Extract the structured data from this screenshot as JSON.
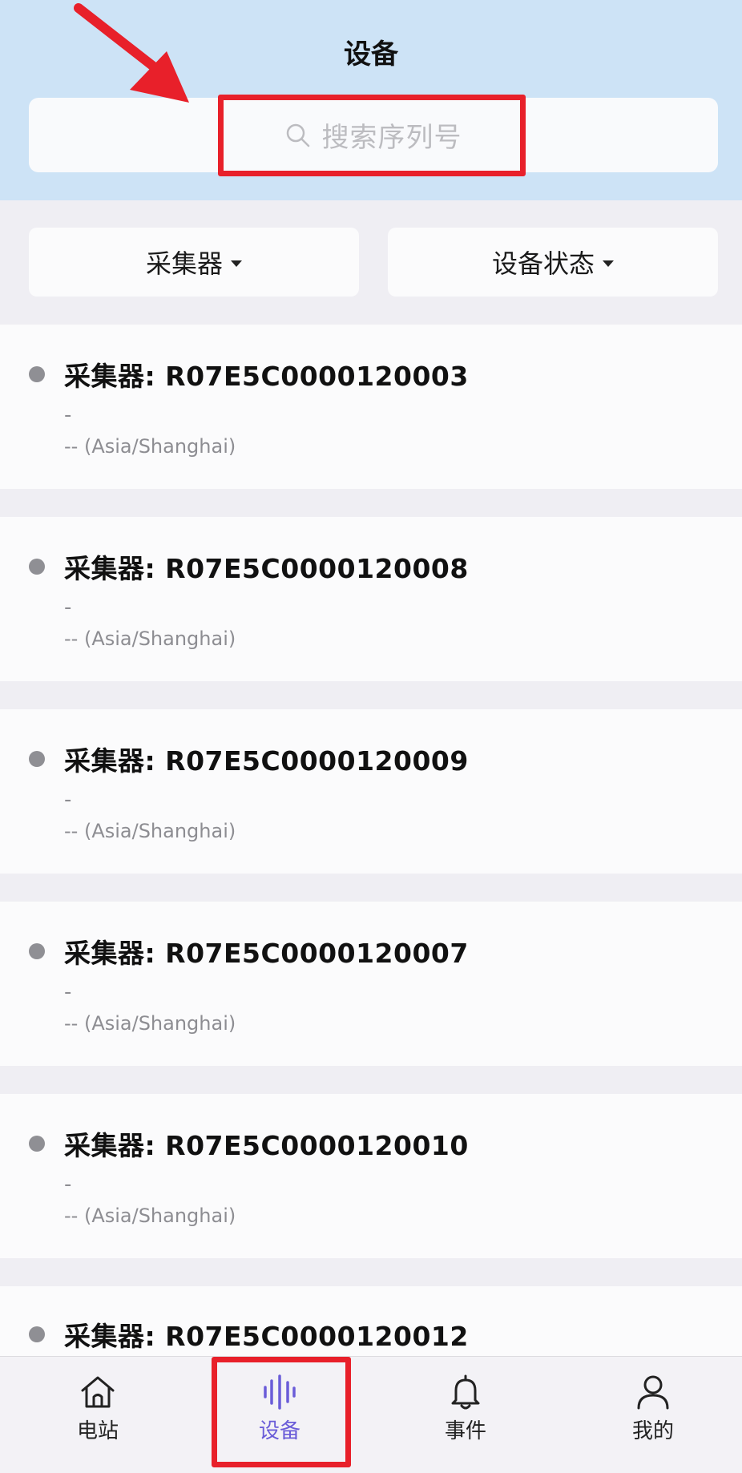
{
  "header": {
    "title": "设备",
    "search_placeholder": "搜索序列号"
  },
  "filters": [
    {
      "label": "采集器"
    },
    {
      "label": "设备状态"
    }
  ],
  "devices": [
    {
      "title": "采集器: R07E5C0000120003",
      "subtitle": "-",
      "timezone": "-- (Asia/Shanghai)"
    },
    {
      "title": "采集器: R07E5C0000120008",
      "subtitle": "-",
      "timezone": "-- (Asia/Shanghai)"
    },
    {
      "title": "采集器: R07E5C0000120009",
      "subtitle": "-",
      "timezone": "-- (Asia/Shanghai)"
    },
    {
      "title": "采集器: R07E5C0000120007",
      "subtitle": "-",
      "timezone": "-- (Asia/Shanghai)"
    },
    {
      "title": "采集器: R07E5C0000120010",
      "subtitle": "-",
      "timezone": "-- (Asia/Shanghai)"
    },
    {
      "title": "采集器: R07E5C0000120012",
      "subtitle": "",
      "timezone": ""
    }
  ],
  "tabbar": {
    "items": [
      {
        "label": "电站",
        "icon": "home-icon"
      },
      {
        "label": "设备",
        "icon": "waveform-icon",
        "active": true
      },
      {
        "label": "事件",
        "icon": "bell-icon"
      },
      {
        "label": "我的",
        "icon": "person-icon"
      }
    ]
  },
  "colors": {
    "header_bg": "#cde3f6",
    "accent": "#6a5cd8",
    "annotation": "#e8202a"
  }
}
